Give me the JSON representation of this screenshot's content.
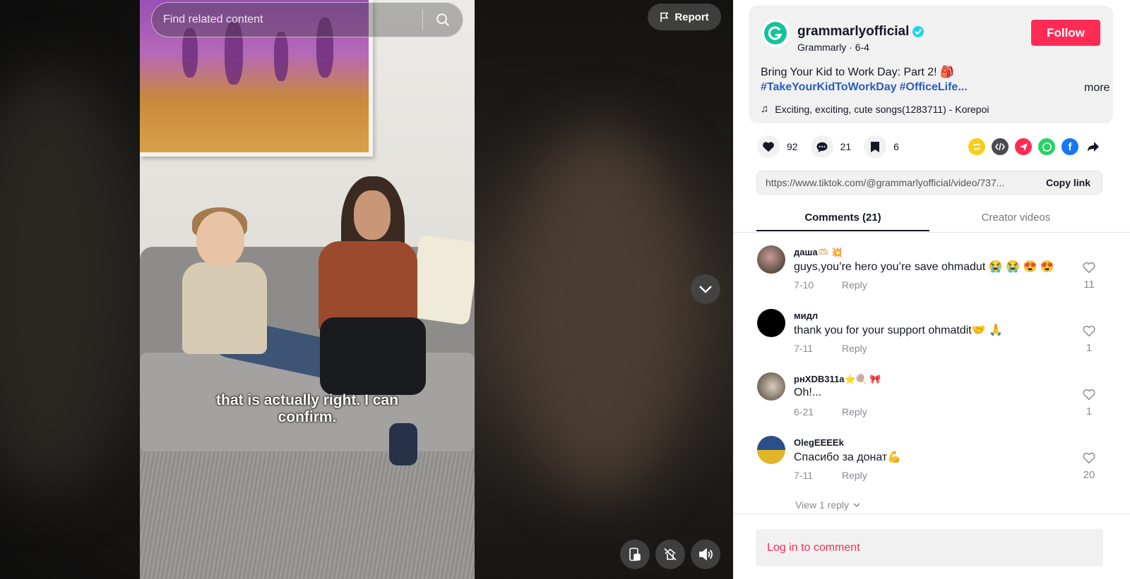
{
  "search": {
    "placeholder": "Find related content"
  },
  "video": {
    "subtitle_line1": "that is actually right. I can",
    "subtitle_line2": "confirm.",
    "report_label": "Report"
  },
  "author": {
    "username": "grammarlyofficial",
    "display_name": "Grammarly",
    "date": "6-4",
    "follow_label": "Follow",
    "brand_color": "#15c39a"
  },
  "post": {
    "description": "Bring Your Kid to Work Day: Part 2! 🎒",
    "hashtags": [
      "#TakeYourKidToWorkDay",
      "#OfficeLife..."
    ],
    "more_label": "more",
    "music": "Exciting, exciting, cute songs(1283711) - Korepoi"
  },
  "stats": {
    "likes": "92",
    "comments": "21",
    "saves": "6"
  },
  "link": {
    "url": "https://www.tiktok.com/@grammarlyofficial/video/737...",
    "copy_label": "Copy link"
  },
  "tabs": [
    {
      "label": "Comments (21)",
      "active": true
    },
    {
      "label": "Creator videos",
      "active": false
    }
  ],
  "comments": [
    {
      "user": "даша🫶🏻 💥",
      "text": "guys,you’re hero you’re save ohmadut 😭 😭 😍 😍",
      "date": "7-10",
      "reply": "Reply",
      "likes": "11",
      "avatar_color": "#6b5a4e"
    },
    {
      "user": "мидл",
      "text": "thank you for your support ohmatdit🤝 🙏",
      "date": "7-11",
      "reply": "Reply",
      "likes": "1",
      "avatar_color": "#000000"
    },
    {
      "user": "рнXDB311a⭐🍭 🎀",
      "text": "Oh!...",
      "date": "6-21",
      "reply": "Reply",
      "likes": "1",
      "avatar_color": "#8a7d6e"
    },
    {
      "user": "OlegEEEEk",
      "text": "Спасибо за донат💪",
      "date": "7-11",
      "reply": "Reply",
      "likes": "20",
      "avatar_color": "#2b4f8a"
    }
  ],
  "view_reply_label": "View 1 reply",
  "login_label": "Log in to comment"
}
